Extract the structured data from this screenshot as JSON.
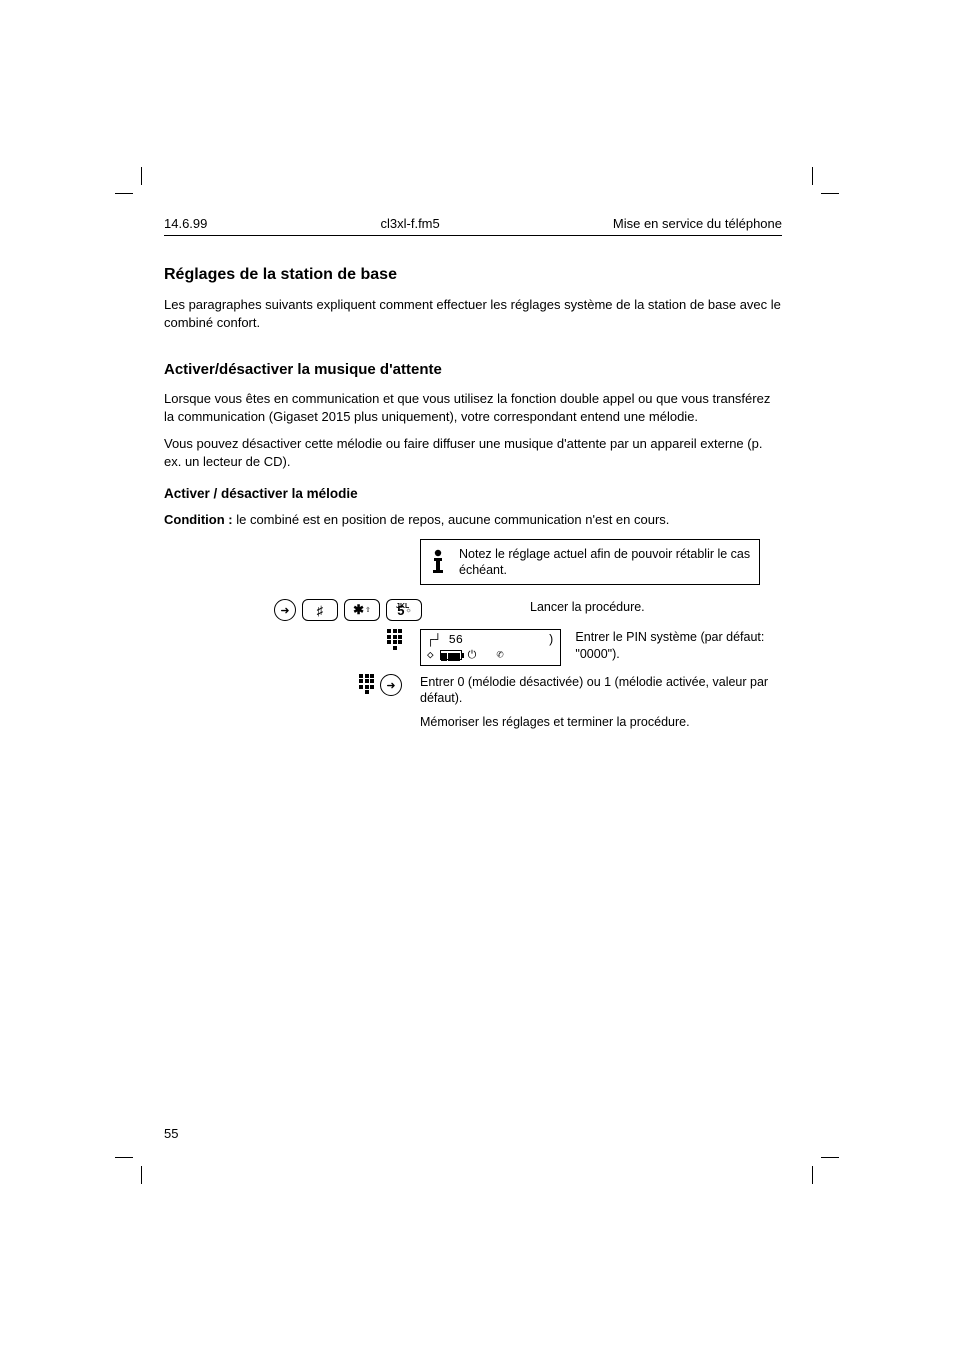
{
  "header": {
    "running_title": "Mise en service du téléphone",
    "page_top": "14.6.99",
    "running_file": "cl3xl-f.fm5",
    "page_number": "55"
  },
  "section": {
    "title": "Réglages de la station de base"
  },
  "intro": {
    "p1": "Les paragraphes suivants expliquent comment effectuer les réglages système de la station de base avec le combiné confort."
  },
  "block1": {
    "title": "Activer/désactiver la musique d'attente",
    "p1": "Lorsque vous êtes en communication et que vous utilisez la fonction double appel ou que vous transférez la communication (Gigaset 2015 plus uniquement), votre correspondant entend une mélodie.",
    "p2": "Vous pouvez désactiver cette mélodie ou faire diffuser une musique d'attente par un appareil externe (p. ex. un lecteur de CD).",
    "sub": "Activer / désactiver la mélodie",
    "condition_label": "Condition :",
    "condition_text": "le combiné est en position de repos, aucune communication n'est en cours.",
    "info_text": "Notez le réglage actuel afin de pouvoir rétablir le cas échéant.",
    "step1_keys_desc": "Lancer la procédure.",
    "step2_keys_desc": "Entrer le PIN système (par défaut: \"0000\").",
    "display_line1_label": "56",
    "display_line1_suffix": ")",
    "step3_text": "Entrer 0 (mélodie désactivée) ou 1 (mélodie activée, valeur par défaut).",
    "step4_text": "Mémoriser les réglages et terminer la procédure."
  },
  "footer": {
    "page_number": "55"
  }
}
